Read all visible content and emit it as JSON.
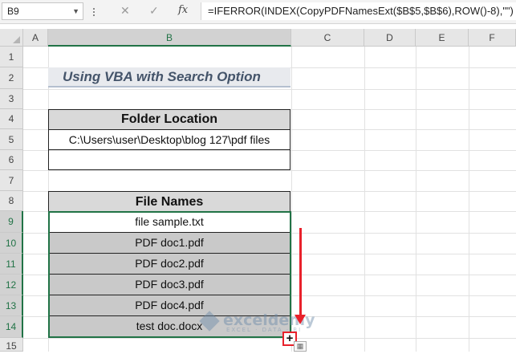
{
  "formula_bar": {
    "name_box": "B9",
    "cancel_symbol": "✕",
    "enter_symbol": "✓",
    "fx_symbol": "fx",
    "formula": "=IFERROR(INDEX(CopyPDFNamesExt($B$5,$B$6),ROW()-8),\"\")"
  },
  "columns": [
    "A",
    "B",
    "C",
    "D",
    "E",
    "F"
  ],
  "selected_column": "B",
  "rows": [
    "1",
    "2",
    "3",
    "4",
    "5",
    "6",
    "7",
    "8",
    "9",
    "10",
    "11",
    "12",
    "13",
    "14",
    "15"
  ],
  "title": "Using VBA with Search Option",
  "folder": {
    "header": "Folder Location",
    "path": "C:\\Users\\user\\Desktop\\blog 127\\pdf files",
    "empty": ""
  },
  "files": {
    "header": "File Names",
    "items": [
      "file sample.txt",
      "PDF doc1.pdf",
      "PDF doc2.pdf",
      "PDF doc3.pdf",
      "PDF doc4.pdf",
      "test doc.docx"
    ]
  },
  "watermark": {
    "name": "exceldemy",
    "tagline": "EXCEL · DATA · BI"
  },
  "colors": {
    "accent": "#217346",
    "annotation_red": "#e8212b",
    "title_text": "#44546a"
  }
}
